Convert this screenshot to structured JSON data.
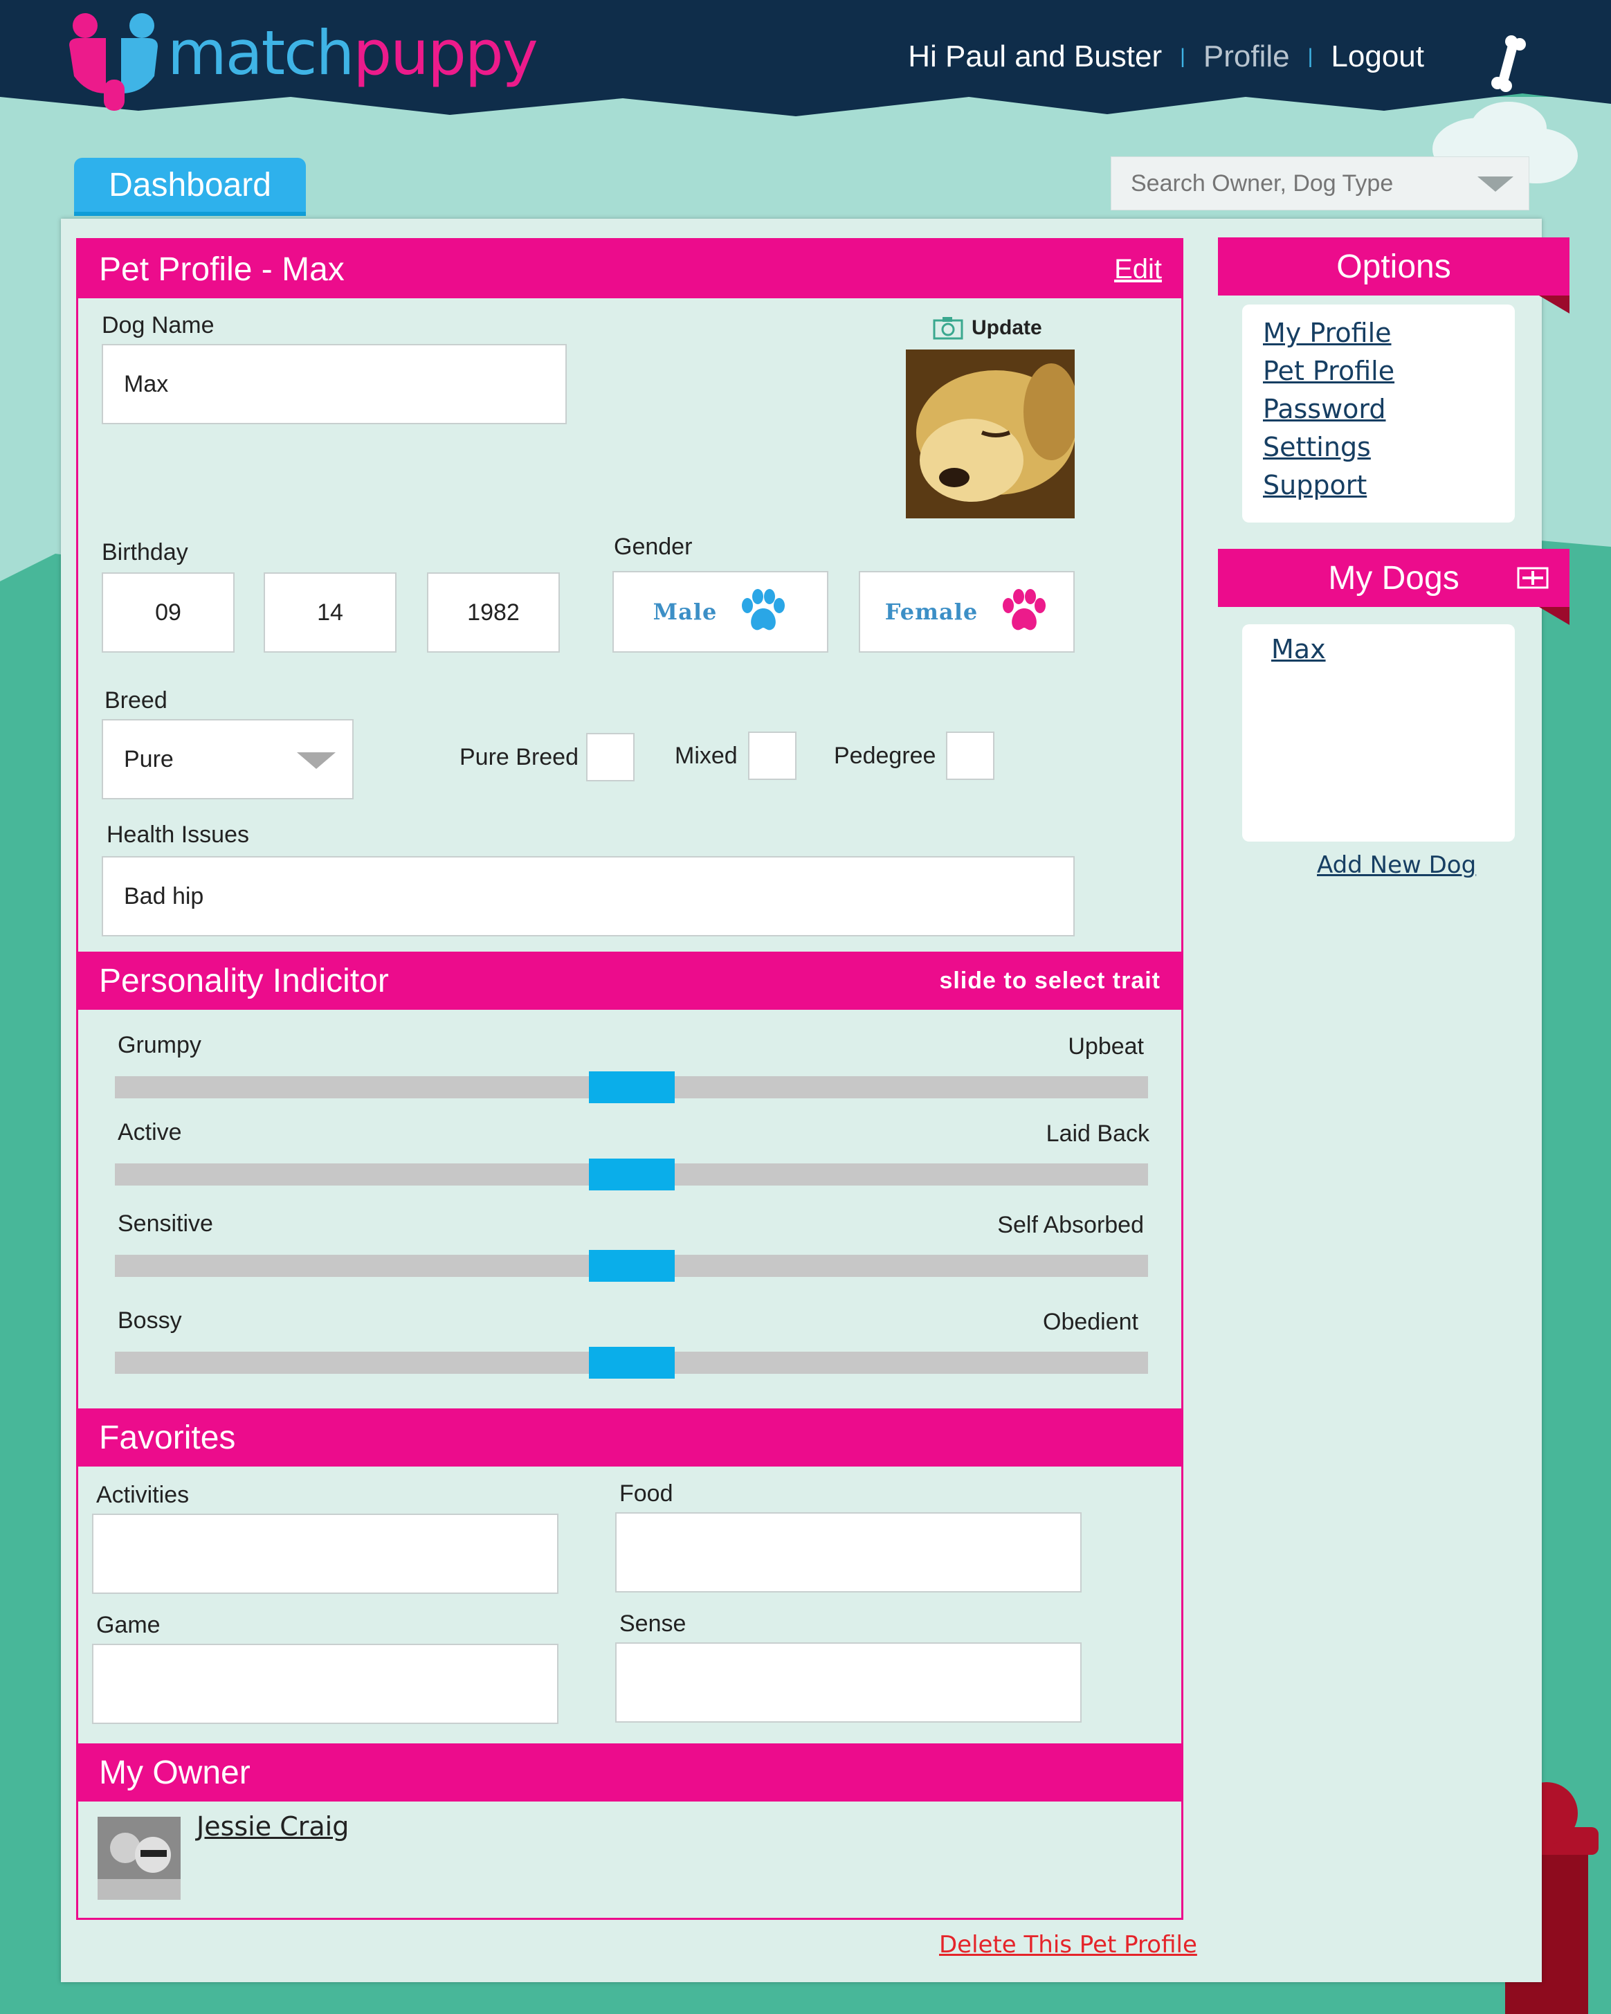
{
  "brand": {
    "logo_part1": "match",
    "logo_part2": "puppy"
  },
  "nav": {
    "greeting": "Hi Paul and Buster",
    "profile": "Profile",
    "logout": "Logout",
    "separator": "|"
  },
  "tabs": {
    "dashboard": "Dashboard"
  },
  "search": {
    "placeholder": "Search Owner, Dog Type"
  },
  "pet_profile": {
    "title": "Pet Profile - Max",
    "edit": "Edit",
    "dog_name_label": "Dog Name",
    "dog_name_value": "Max",
    "photo_update": "Update",
    "birthday_label": "Birthday",
    "birthday": {
      "month": "09",
      "day": "14",
      "year": "1982"
    },
    "gender_label": "Gender",
    "gender_male": "Male",
    "gender_female": "Female",
    "breed_label": "Breed",
    "breed_value": "Pure",
    "breed_options": {
      "pure_breed": "Pure Breed",
      "mixed": "Mixed",
      "pedegree": "Pedegree"
    },
    "health_label": "Health Issues",
    "health_value": "Bad hip"
  },
  "personality": {
    "title": "Personality Indicitor",
    "hint": "slide to select trait",
    "traits": [
      {
        "left": "Grumpy",
        "right": "Upbeat",
        "value": 0.5
      },
      {
        "left": "Active",
        "right": "Laid Back",
        "value": 0.5
      },
      {
        "left": "Sensitive",
        "right": "Self Absorbed",
        "value": 0.5
      },
      {
        "left": "Bossy",
        "right": "Obedient",
        "value": 0.5
      }
    ]
  },
  "favorites": {
    "title": "Favorites",
    "activities": "Activities",
    "food": "Food",
    "game": "Game",
    "sense": "Sense"
  },
  "owner": {
    "title": "My Owner",
    "name": "Jessie Craig"
  },
  "delete_link": "Delete This Pet Profile",
  "options": {
    "title": "Options",
    "links": [
      "My Profile",
      "Pet Profile",
      "Password",
      "Settings",
      "Support"
    ]
  },
  "my_dogs": {
    "title": "My Dogs",
    "dogs": [
      "Max"
    ],
    "add": "Add New Dog"
  },
  "colors": {
    "brand_pink": "#ec0c8c",
    "brand_blue": "#3fb4e6",
    "header_navy": "#0f2d4a",
    "slider_blue": "#0aaeea"
  }
}
